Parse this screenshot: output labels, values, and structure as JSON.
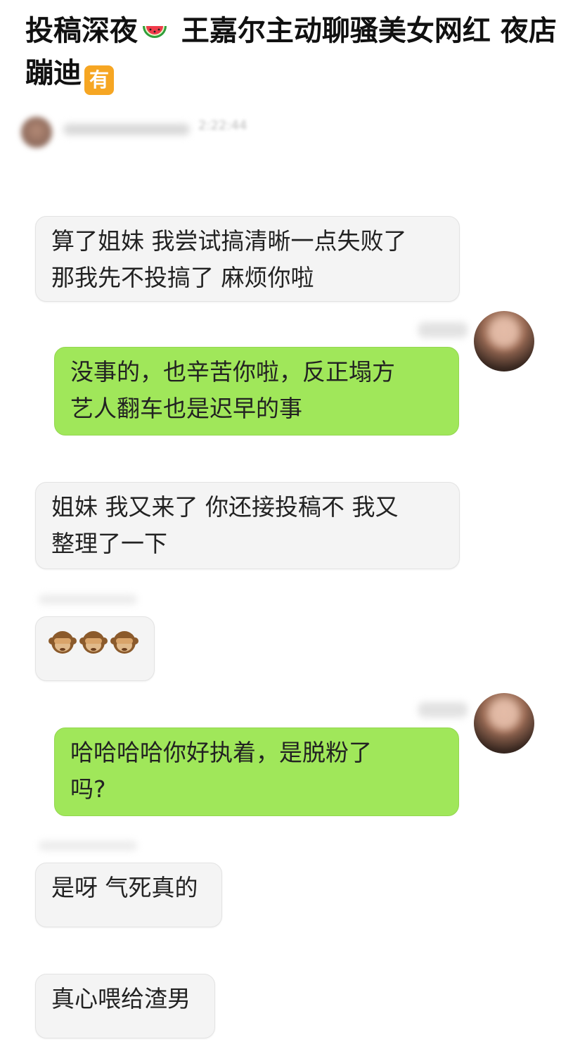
{
  "post": {
    "title_part1": "投稿深夜",
    "emoji": "watermelon",
    "title_part2": " 王嘉尔主动聊骚美女网红 夜店蹦迪",
    "badge": "有",
    "blurred_timestamp": "2:22:44"
  },
  "messages": [
    {
      "side": "left",
      "text_lines": [
        "算了姐妹 我尝试搞清晰一点失败了",
        "那我先不投搞了 麻烦你啦"
      ]
    },
    {
      "side": "right",
      "text_lines": [
        "没事的，也辛苦你啦，反正塌方",
        "艺人翻车也是迟早的事"
      ]
    },
    {
      "side": "left",
      "text_lines": [
        "姐妹 我又来了 你还接投稿不 我又",
        "整理了一下"
      ]
    },
    {
      "side": "left",
      "emoji": "see-no-evil-monkey",
      "emoji_count": 3
    },
    {
      "side": "right",
      "text_lines": [
        "哈哈哈哈你好执着，是脱粉了",
        "吗?"
      ]
    },
    {
      "side": "left",
      "text_lines": [
        "是呀 气死真的"
      ]
    },
    {
      "side": "left",
      "text_lines": [
        "真心喂给渣男"
      ]
    }
  ],
  "colors": {
    "right_bubble": "#a0e75a",
    "left_bubble": "#f4f4f4",
    "badge": "#f6a623"
  }
}
